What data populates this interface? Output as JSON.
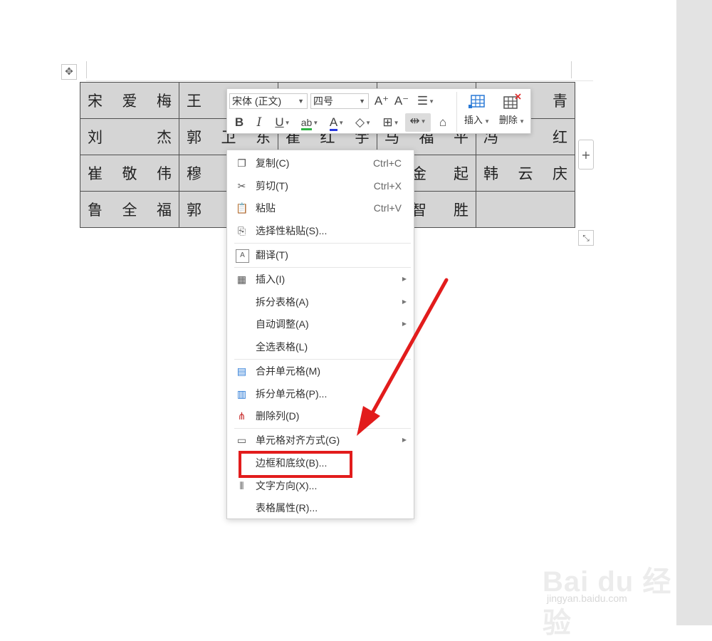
{
  "table": {
    "rows": [
      [
        "宋 爱 梅",
        "王 志",
        "",
        "",
        "燕 青"
      ],
      [
        "刘 杰",
        "郭 卫 东",
        "崔 红 宇",
        "马 福 平",
        "冯 红"
      ],
      [
        "崔 敬 伟",
        "穆 坤",
        "",
        "金 起",
        "韩 云 庆"
      ],
      [
        "鲁 全 福",
        "郭 娟",
        "",
        "智 胜",
        ""
      ]
    ]
  },
  "mini_toolbar": {
    "font_name": "宋体 (正文)",
    "font_size": "四号",
    "insert_label": "插入",
    "delete_label": "删除"
  },
  "context_menu": {
    "items": [
      {
        "label": "复制(C)",
        "shortcut": "Ctrl+C",
        "icon": "copy-icon"
      },
      {
        "label": "剪切(T)",
        "shortcut": "Ctrl+X",
        "icon": "scissors-icon"
      },
      {
        "label": "粘贴",
        "shortcut": "Ctrl+V",
        "icon": "paste-icon"
      },
      {
        "label": "选择性粘贴(S)...",
        "icon": "paste-special-icon"
      },
      {
        "label": "翻译(T)",
        "icon": "translate-icon"
      },
      {
        "label": "插入(I)",
        "icon": "table-insert-icon",
        "submenu": true
      },
      {
        "label": "拆分表格(A)",
        "submenu": true
      },
      {
        "label": "自动调整(A)",
        "submenu": true
      },
      {
        "label": "全选表格(L)"
      },
      {
        "label": "合并单元格(M)",
        "icon": "merge-cells-icon"
      },
      {
        "label": "拆分单元格(P)...",
        "icon": "split-cells-icon"
      },
      {
        "label": "删除列(D)",
        "icon": "delete-column-icon"
      },
      {
        "label": "单元格对齐方式(G)",
        "icon": "cell-align-icon",
        "submenu": true
      },
      {
        "label": "边框和底纹(B)..."
      },
      {
        "label": "文字方向(X)...",
        "icon": "text-direction-icon"
      },
      {
        "label": "表格属性(R)..."
      }
    ]
  },
  "annotation_color": "#e21c1c",
  "watermark": {
    "brand": "Bai du 经验",
    "url": "jingyan.baidu.com"
  }
}
